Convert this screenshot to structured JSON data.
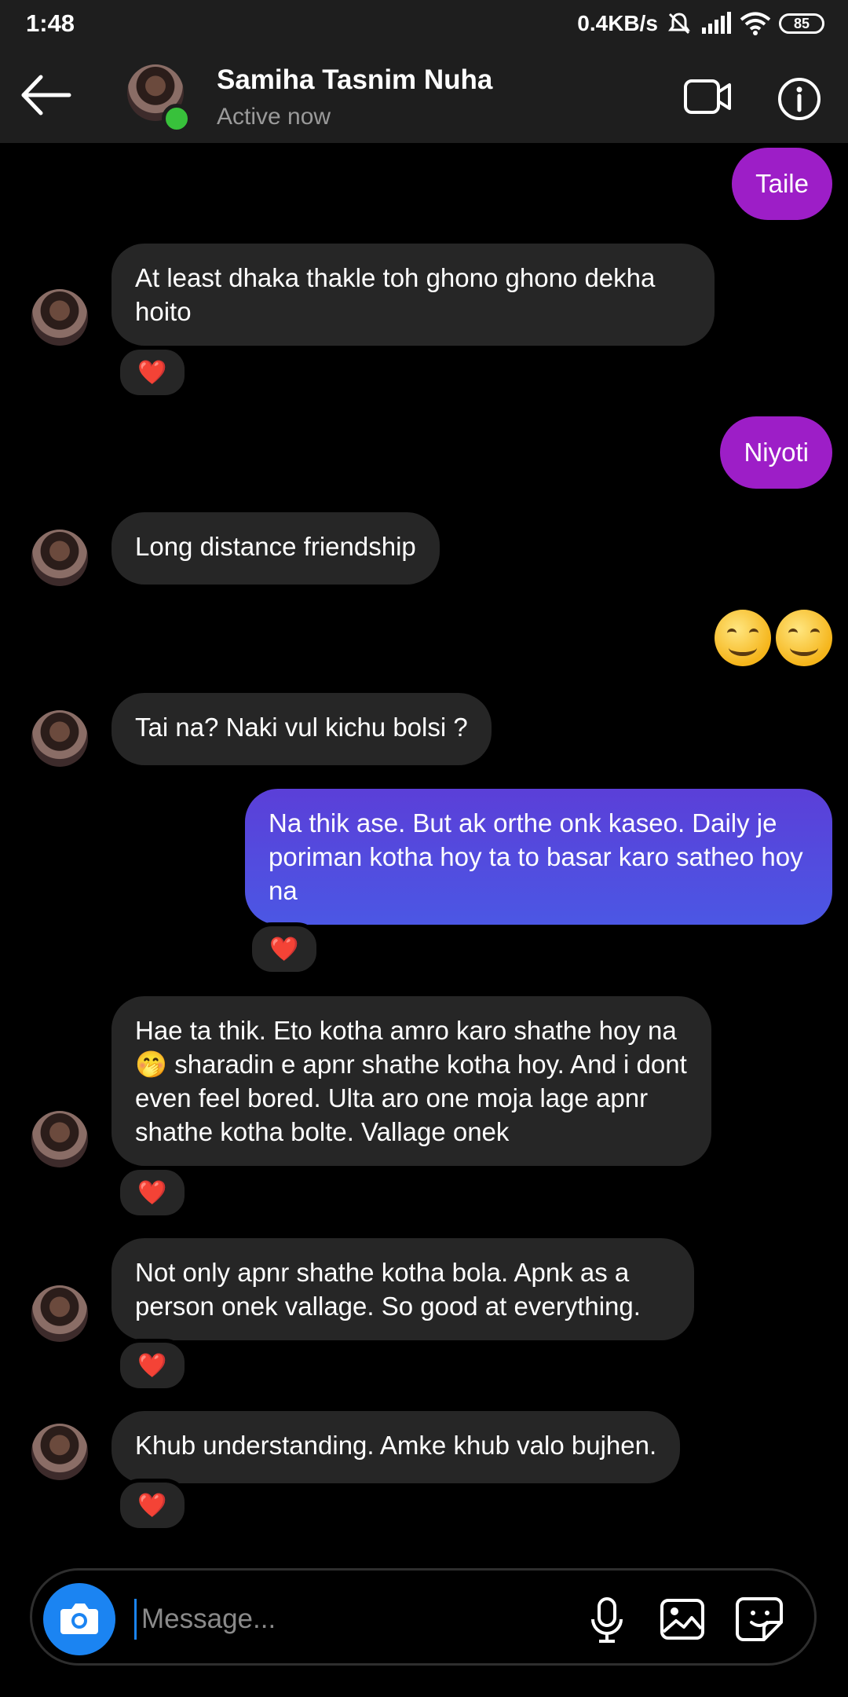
{
  "statusbar": {
    "time": "1:48",
    "speed": "0.4KB/s",
    "battery": "85"
  },
  "header": {
    "name": "Samiha Tasnim Nuha",
    "status": "Active now"
  },
  "messages": [
    {
      "dir": "out",
      "text": "Taile"
    },
    {
      "dir": "in",
      "text": "At least dhaka thakle toh ghono ghono dekha hoito",
      "reaction": "❤️"
    },
    {
      "dir": "out",
      "text": "Niyoti"
    },
    {
      "dir": "in",
      "text": "Long distance friendship"
    },
    {
      "dir": "out",
      "text": "😊😊"
    },
    {
      "dir": "in",
      "text": "Tai na? Naki vul kichu bolsi ?"
    },
    {
      "dir": "out",
      "text": "Na thik ase. But ak orthe onk kaseo. Daily je poriman kotha hoy ta to basar karo satheo hoy na",
      "reaction": "❤️"
    },
    {
      "dir": "in",
      "text": "Hae ta thik. Eto kotha amro karo shathe hoy na 🤭 sharadin e apnr shathe kotha hoy. And i dont even feel bored. Ulta aro one moja lage apnr shathe kotha bolte. Vallage onek",
      "reaction": "❤️"
    },
    {
      "dir": "in",
      "text": "Not only apnr shathe kotha bola. Apnk as a person onek vallage. So good at everything.",
      "reaction": "❤️"
    },
    {
      "dir": "in",
      "text": "Khub understanding. Amke khub valo bujhen.",
      "reaction": "❤️"
    }
  ],
  "composer": {
    "placeholder": "Message..."
  },
  "colors": {
    "outgoing": "#9d1ec7",
    "outgoing_blue": "#4b57e4",
    "incoming": "#262626",
    "camera": "#1b84f2",
    "online": "#38c13b"
  }
}
